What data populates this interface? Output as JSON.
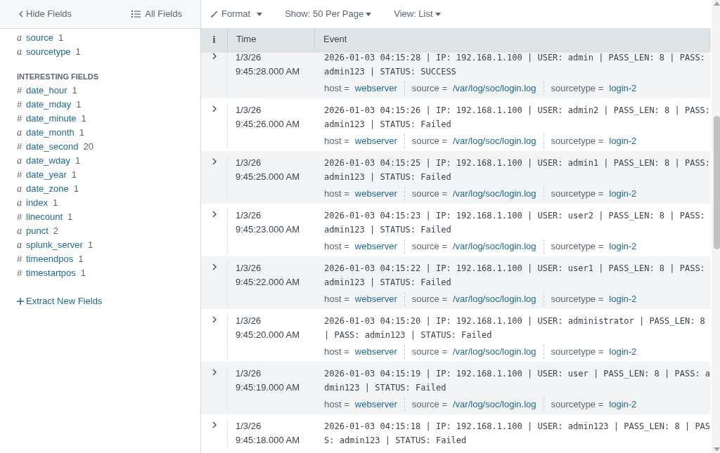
{
  "sidebar": {
    "hide_fields_label": "Hide Fields",
    "all_fields_label": "All Fields",
    "selected_fields": [
      {
        "type": "a",
        "name": "source",
        "count": "1"
      },
      {
        "type": "a",
        "name": "sourcetype",
        "count": "1"
      }
    ],
    "section_title": "INTERESTING FIELDS",
    "interesting_fields": [
      {
        "type": "#",
        "name": "date_hour",
        "count": "1"
      },
      {
        "type": "#",
        "name": "date_mday",
        "count": "1"
      },
      {
        "type": "#",
        "name": "date_minute",
        "count": "1"
      },
      {
        "type": "a",
        "name": "date_month",
        "count": "1"
      },
      {
        "type": "#",
        "name": "date_second",
        "count": "20"
      },
      {
        "type": "a",
        "name": "date_wday",
        "count": "1"
      },
      {
        "type": "#",
        "name": "date_year",
        "count": "1"
      },
      {
        "type": "a",
        "name": "date_zone",
        "count": "1"
      },
      {
        "type": "a",
        "name": "index",
        "count": "1"
      },
      {
        "type": "#",
        "name": "linecount",
        "count": "1"
      },
      {
        "type": "a",
        "name": "punct",
        "count": "2"
      },
      {
        "type": "a",
        "name": "splunk_server",
        "count": "1"
      },
      {
        "type": "#",
        "name": "timeendpos",
        "count": "1"
      },
      {
        "type": "#",
        "name": "timestartpos",
        "count": "1"
      }
    ],
    "extract_link": "Extract New Fields"
  },
  "toolbar": [
    {
      "label": "Format",
      "kind": "format"
    },
    {
      "label": "Show: 50 Per Page",
      "kind": "menu"
    },
    {
      "label": "View: List",
      "kind": "menu"
    }
  ],
  "table": {
    "columns": [
      "i",
      "Time",
      "Event"
    ],
    "rows": [
      {
        "date": "1/3/26",
        "time": "9:45:28.000 AM",
        "event_lines": [
          "2026-01-03 04:15:28 | IP: 192.168.1.100 | USER: admin | PASS_LEN: 8 | PASS:",
          "admin123 | STATUS: SUCCESS"
        ],
        "fields": [
          {
            "key": "host =",
            "value": "webserver"
          },
          {
            "key": "source =",
            "value": "/var/log/soc/login.log"
          },
          {
            "key": "sourcetype =",
            "value": "login-2"
          }
        ]
      },
      {
        "date": "1/3/26",
        "time": "9:45:26.000 AM",
        "event_lines": [
          "2026-01-03 04:15:26 | IP: 192.168.1.100 | USER: admin2 | PASS_LEN: 8 | PASS:",
          "admin123 | STATUS: Failed"
        ],
        "fields": [
          {
            "key": "host =",
            "value": "webserver"
          },
          {
            "key": "source =",
            "value": "/var/log/soc/login.log"
          },
          {
            "key": "sourcetype =",
            "value": "login-2"
          }
        ]
      },
      {
        "date": "1/3/26",
        "time": "9:45:25.000 AM",
        "event_lines": [
          "2026-01-03 04:15:25 | IP: 192.168.1.100 | USER: admin1 | PASS_LEN: 8 | PASS:",
          "admin123 | STATUS: Failed"
        ],
        "fields": [
          {
            "key": "host =",
            "value": "webserver"
          },
          {
            "key": "source =",
            "value": "/var/log/soc/login.log"
          },
          {
            "key": "sourcetype =",
            "value": "login-2"
          }
        ]
      },
      {
        "date": "1/3/26",
        "time": "9:45:23.000 AM",
        "event_lines": [
          "2026-01-03 04:15:23 | IP: 192.168.1.100 | USER: user2 | PASS_LEN: 8 | PASS:",
          "admin123 | STATUS: Failed"
        ],
        "fields": [
          {
            "key": "host =",
            "value": "webserver"
          },
          {
            "key": "source =",
            "value": "/var/log/soc/login.log"
          },
          {
            "key": "sourcetype =",
            "value": "login-2"
          }
        ]
      },
      {
        "date": "1/3/26",
        "time": "9:45:22.000 AM",
        "event_lines": [
          "2026-01-03 04:15:22 | IP: 192.168.1.100 | USER: user1 | PASS_LEN: 8 | PASS:",
          "admin123 | STATUS: Failed"
        ],
        "fields": [
          {
            "key": "host =",
            "value": "webserver"
          },
          {
            "key": "source =",
            "value": "/var/log/soc/login.log"
          },
          {
            "key": "sourcetype =",
            "value": "login-2"
          }
        ]
      },
      {
        "date": "1/3/26",
        "time": "9:45:20.000 AM",
        "event_lines": [
          "2026-01-03 04:15:20 | IP: 192.168.1.100 | USER: administrator | PASS_LEN: 8",
          "| PASS: admin123 | STATUS: Failed"
        ],
        "fields": [
          {
            "key": "host =",
            "value": "webserver"
          },
          {
            "key": "source =",
            "value": "/var/log/soc/login.log"
          },
          {
            "key": "sourcetype =",
            "value": "login-2"
          }
        ]
      },
      {
        "date": "1/3/26",
        "time": "9:45:19.000 AM",
        "event_lines": [
          "2026-01-03 04:15:19 | IP: 192.168.1.100 | USER: user | PASS_LEN: 8 | PASS: a",
          "dmin123 | STATUS: Failed"
        ],
        "fields": [
          {
            "key": "host =",
            "value": "webserver"
          },
          {
            "key": "source =",
            "value": "/var/log/soc/login.log"
          },
          {
            "key": "sourcetype =",
            "value": "login-2"
          }
        ]
      },
      {
        "date": "1/3/26",
        "time": "9:45:18.000 AM",
        "event_lines": [
          "2026-01-03 04:15:18 | IP: 192.168.1.100 | USER: admin123 | PASS_LEN: 8 | PAS",
          "S: admin123 | STATUS: Failed"
        ]
      }
    ]
  }
}
